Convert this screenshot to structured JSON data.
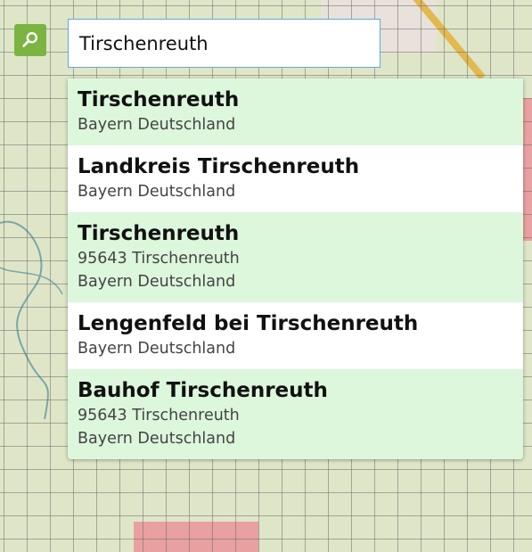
{
  "search": {
    "value": "Tirschenreuth",
    "icon": "search-icon"
  },
  "suggestions": [
    {
      "name": "Tirschenreuth",
      "lines": [
        "Bayern Deutschland"
      ]
    },
    {
      "name": "Landkreis Tirschenreuth",
      "lines": [
        "Bayern Deutschland"
      ]
    },
    {
      "name": "Tirschenreuth",
      "lines": [
        "95643 Tirschenreuth",
        "Bayern Deutschland"
      ]
    },
    {
      "name": "Lengenfeld bei Tirschenreuth",
      "lines": [
        "Bayern Deutschland"
      ]
    },
    {
      "name": "Bauhof Tirschenreuth",
      "lines": [
        "95643 Tirschenreuth",
        "Bayern Deutschland"
      ]
    }
  ],
  "colors": {
    "search_button": "#7bb441",
    "suggestion_alt_bg": "#dcf7dc",
    "input_border": "#5aa8e0"
  }
}
